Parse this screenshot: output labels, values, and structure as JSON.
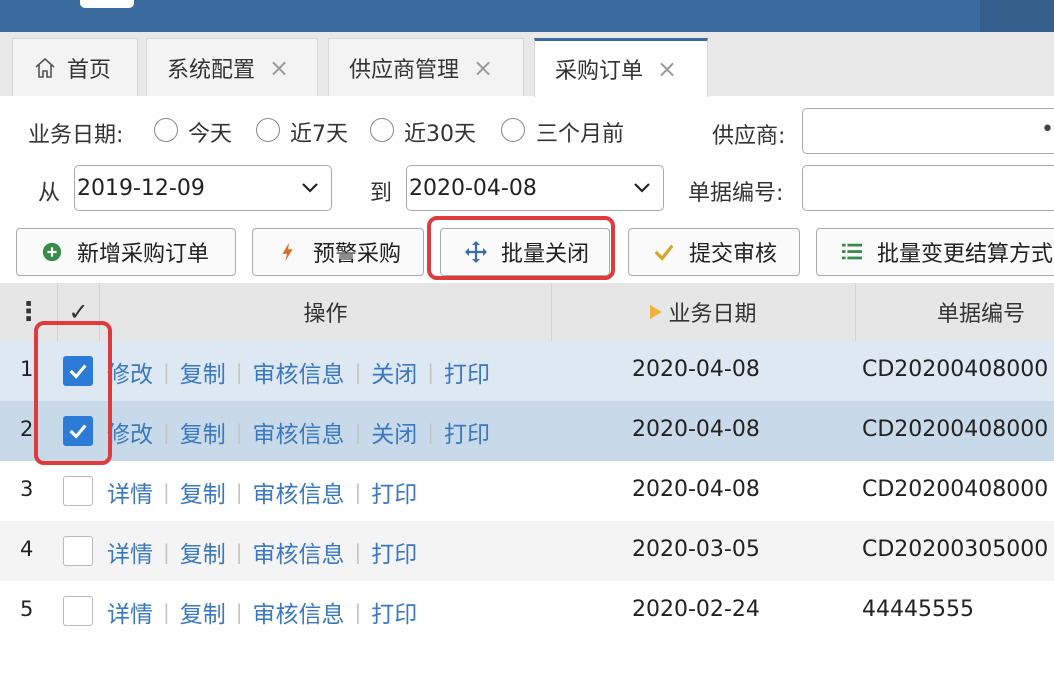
{
  "tabs": [
    {
      "label": "首页",
      "closable": false
    },
    {
      "label": "系统配置",
      "closable": true
    },
    {
      "label": "供应商管理",
      "closable": true
    },
    {
      "label": "采购订单",
      "closable": true,
      "active": true
    }
  ],
  "tab_close_glyph": "×",
  "filters": {
    "date_label": "业务日期:",
    "date_options": [
      "今天",
      "近7天",
      "近30天",
      "三个月前"
    ],
    "supplier_label": "供应商:",
    "from_label": "从",
    "from_value": "2019-12-09",
    "to_label": "到",
    "to_value": "2020-04-08",
    "docno_label": "单据编号:"
  },
  "toolbar": [
    {
      "label": "新增采购订单",
      "icon": "plus-circle-icon",
      "color": "#3a8a4a"
    },
    {
      "label": "预警采购",
      "icon": "lightning-icon",
      "color": "#e06a2a"
    },
    {
      "label": "批量关闭",
      "icon": "move-arrows-icon",
      "color": "#3a6bb0"
    },
    {
      "label": "提交审核",
      "icon": "checkmark-icon",
      "color": "#d4a82a"
    },
    {
      "label": "批量变更结算方式",
      "icon": "list-icon",
      "color": "#3a8a4a"
    }
  ],
  "table": {
    "menu_glyph": "⋮",
    "check_glyph": "✓",
    "headers": {
      "ops": "操作",
      "date": "业务日期",
      "docno": "单据编号"
    },
    "rows": [
      {
        "num": "1",
        "checked": true,
        "ops": [
          "修改",
          "复制",
          "审核信息",
          "关闭",
          "打印"
        ],
        "date": "2020-04-08",
        "docno": "CD20200408000"
      },
      {
        "num": "2",
        "checked": true,
        "ops": [
          "修改",
          "复制",
          "审核信息",
          "关闭",
          "打印"
        ],
        "date": "2020-04-08",
        "docno": "CD20200408000"
      },
      {
        "num": "3",
        "checked": false,
        "ops": [
          "详情",
          "复制",
          "审核信息",
          "打印"
        ],
        "date": "2020-04-08",
        "docno": "CD20200408000"
      },
      {
        "num": "4",
        "checked": false,
        "ops": [
          "详情",
          "复制",
          "审核信息",
          "打印"
        ],
        "date": "2020-03-05",
        "docno": "CD20200305000"
      },
      {
        "num": "5",
        "checked": false,
        "ops": [
          "详情",
          "复制",
          "审核信息",
          "打印"
        ],
        "date": "2020-02-24",
        "docno": "44445555"
      }
    ]
  },
  "colors": {
    "link": "#3a78bf",
    "header_bar": "#3a6b9e",
    "selected_row": "#c8dae9",
    "hover_row": "#dde8f2",
    "highlight": "#e03a3a"
  }
}
